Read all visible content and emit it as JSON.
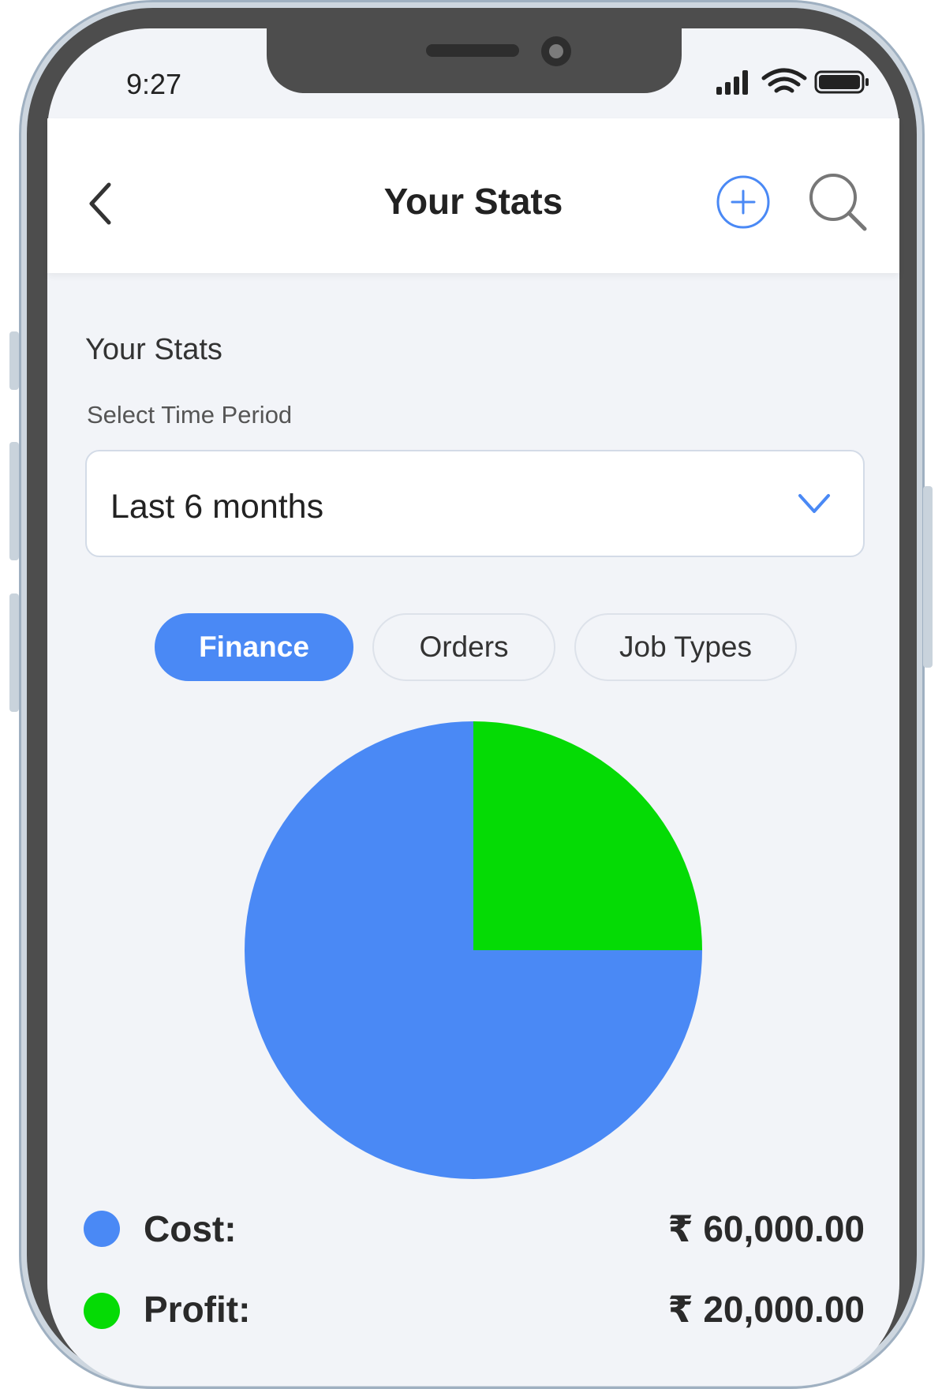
{
  "status_bar": {
    "time": "9:27"
  },
  "header": {
    "title": "Your Stats"
  },
  "content": {
    "section_title": "Your Stats",
    "time_period_label": "Select Time Period",
    "time_period_value": "Last 6 months"
  },
  "tabs": [
    {
      "label": "Finance",
      "active": true
    },
    {
      "label": "Orders",
      "active": false
    },
    {
      "label": "Job Types",
      "active": false
    }
  ],
  "legend": [
    {
      "label": "Cost:",
      "value": "₹ 60,000.00",
      "color": "#4a89f5"
    },
    {
      "label": "Profit:",
      "value": "₹ 20,000.00",
      "color": "#05db05"
    }
  ],
  "chart_data": {
    "type": "pie",
    "categories": [
      "Cost",
      "Profit"
    ],
    "values": [
      60000,
      20000
    ],
    "colors": [
      "#4a89f5",
      "#05db05"
    ]
  },
  "colors": {
    "accent": "#4a89f5",
    "profit": "#05db05",
    "background": "#f2f4f8"
  },
  "icons": {
    "back": "chevron-left-icon",
    "add": "plus-circle-icon",
    "search": "search-icon",
    "dropdown": "chevron-down-icon"
  }
}
